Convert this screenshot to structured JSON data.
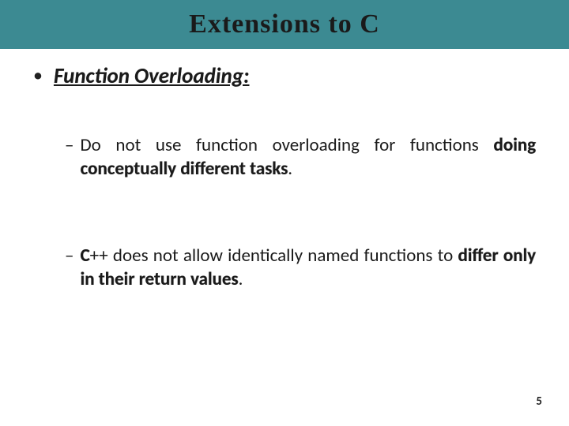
{
  "slide": {
    "title": "Extensions to C",
    "heading": "Function Overloading:",
    "items": [
      {
        "pre": "Do not use function overloading for functions ",
        "emph": "doing conceptually different tasks",
        "post": "."
      },
      {
        "prebold": "C",
        "pre": "++ does not allow identically named functions to ",
        "emph": "differ only in their return values",
        "post": "."
      }
    ],
    "page_number": "5"
  }
}
